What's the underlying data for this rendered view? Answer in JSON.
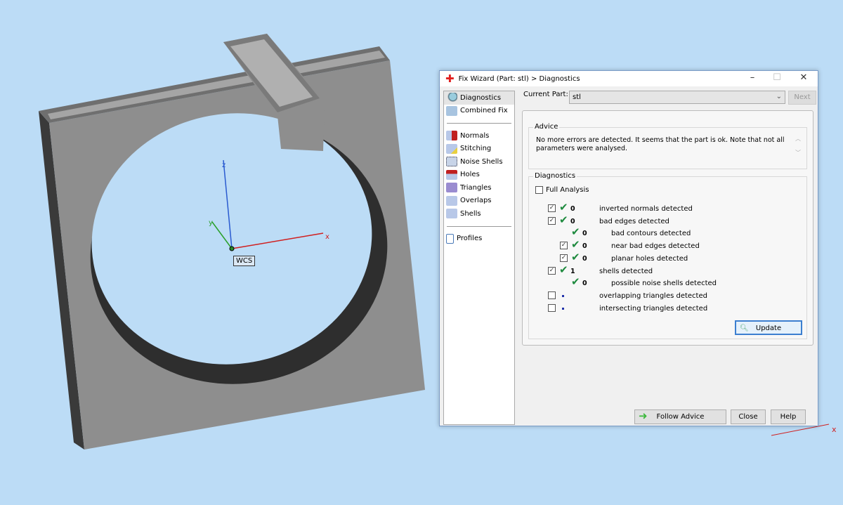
{
  "viewport": {
    "wcs_label": "WCS",
    "axes": {
      "x": "x",
      "y": "y",
      "z": "z"
    }
  },
  "dialog": {
    "title": "Fix Wizard (Part: stl) > Diagnostics",
    "nav": [
      {
        "label": "Diagnostics",
        "icon": "magnifier-icon",
        "selected": true
      },
      {
        "label": "Combined Fix",
        "icon": "cube-icon"
      },
      {
        "label": "Normals",
        "icon": "normals-cube-icon"
      },
      {
        "label": "Stitching",
        "icon": "stitching-cube-icon"
      },
      {
        "label": "Noise Shells",
        "icon": "dice-icon"
      },
      {
        "label": "Holes",
        "icon": "holes-cube-icon"
      },
      {
        "label": "Triangles",
        "icon": "triangles-cube-icon"
      },
      {
        "label": "Overlaps",
        "icon": "overlaps-cube-icon"
      },
      {
        "label": "Shells",
        "icon": "shells-cube-icon"
      },
      {
        "label": "Profiles",
        "icon": "document-icon"
      }
    ],
    "current_part_label": "Current Part:",
    "current_part_value": "stl",
    "next_label": "Next",
    "advice_title": "Advice",
    "advice_text": "No more errors are detected. It seems that the part is ok. Note that not all parameters were analysed.",
    "diagnostics_title": "Diagnostics",
    "full_analysis_label": "Full Analysis",
    "rows": [
      {
        "checkbox": true,
        "checked": true,
        "status": "ok",
        "value": "0",
        "label": "inverted normals detected",
        "indent": 0
      },
      {
        "checkbox": true,
        "checked": true,
        "status": "ok",
        "value": "0",
        "label": "bad edges detected",
        "indent": 0
      },
      {
        "checkbox": false,
        "status": "ok",
        "value": "0",
        "label": "bad contours detected",
        "indent": 1
      },
      {
        "checkbox": true,
        "checked": true,
        "status": "ok",
        "value": "0",
        "label": "near bad edges detected",
        "indent": 1
      },
      {
        "checkbox": true,
        "checked": true,
        "status": "ok",
        "value": "0",
        "label": "planar holes detected",
        "indent": 1
      },
      {
        "checkbox": true,
        "checked": true,
        "status": "ok",
        "value": "1",
        "label": "shells detected",
        "indent": 0
      },
      {
        "checkbox": false,
        "status": "ok",
        "value": "0",
        "label": "possible noise shells detected",
        "indent": 1
      },
      {
        "checkbox": true,
        "checked": false,
        "status": "pending",
        "value": "",
        "label": "overlapping triangles detected",
        "indent": 0
      },
      {
        "checkbox": true,
        "checked": false,
        "status": "pending",
        "value": "",
        "label": "intersecting triangles detected",
        "indent": 0
      }
    ],
    "update_label": "Update",
    "follow_advice_label": "Follow Advice",
    "close_label": "Close",
    "help_label": "Help"
  }
}
